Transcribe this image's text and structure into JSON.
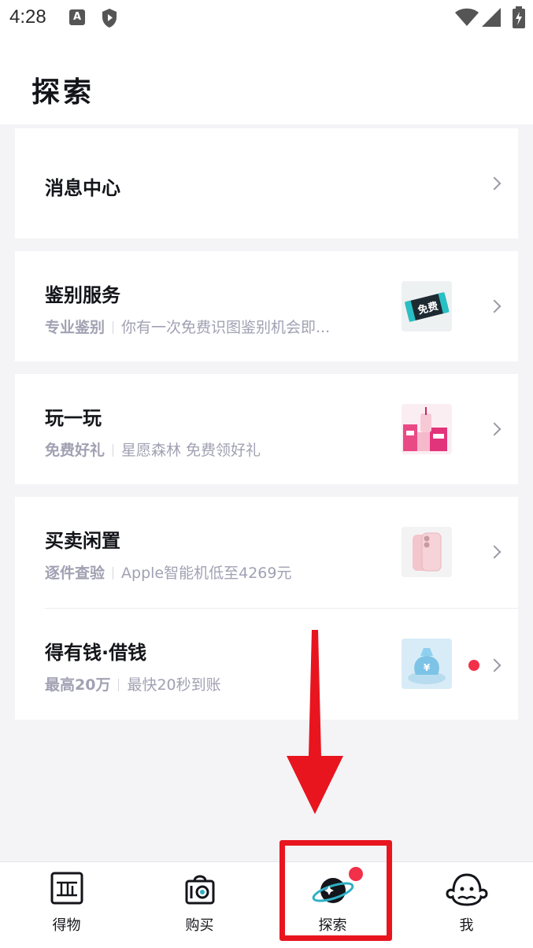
{
  "status_bar": {
    "time": "4:28",
    "icons": [
      "notification-a-icon",
      "shield-icon",
      "wifi-icon",
      "signal-icon",
      "battery-icon"
    ]
  },
  "header": {
    "title": "探索"
  },
  "menu": {
    "message_center": {
      "title": "消息中心"
    },
    "appraisal": {
      "title": "鉴别服务",
      "tag": "专业鉴别",
      "desc": "你有一次免费识图鉴别机会即...",
      "thumb_text": "免费"
    },
    "play": {
      "title": "玩一玩",
      "tag": "免费好礼",
      "desc": "星愿森林 免费领好礼"
    },
    "secondhand": {
      "title": "买卖闲置",
      "tag": "逐件查验",
      "desc": "Apple智能机低至4269元"
    },
    "loan": {
      "title": "得有钱·借钱",
      "tag": "最高20万",
      "desc": "最快20秒到账"
    }
  },
  "tabbar": {
    "items": [
      {
        "label": "得物",
        "icon": "dewu-logo-icon"
      },
      {
        "label": "购买",
        "icon": "shopping-bag-icon"
      },
      {
        "label": "探索",
        "icon": "planet-icon"
      },
      {
        "label": "我",
        "icon": "monster-avatar-icon"
      }
    ]
  },
  "colors": {
    "accent_red": "#f2304a",
    "highlight_red": "#e8151f",
    "text_primary": "#14151a",
    "text_secondary": "#a1a1b3",
    "background": "#f4f4f6"
  }
}
